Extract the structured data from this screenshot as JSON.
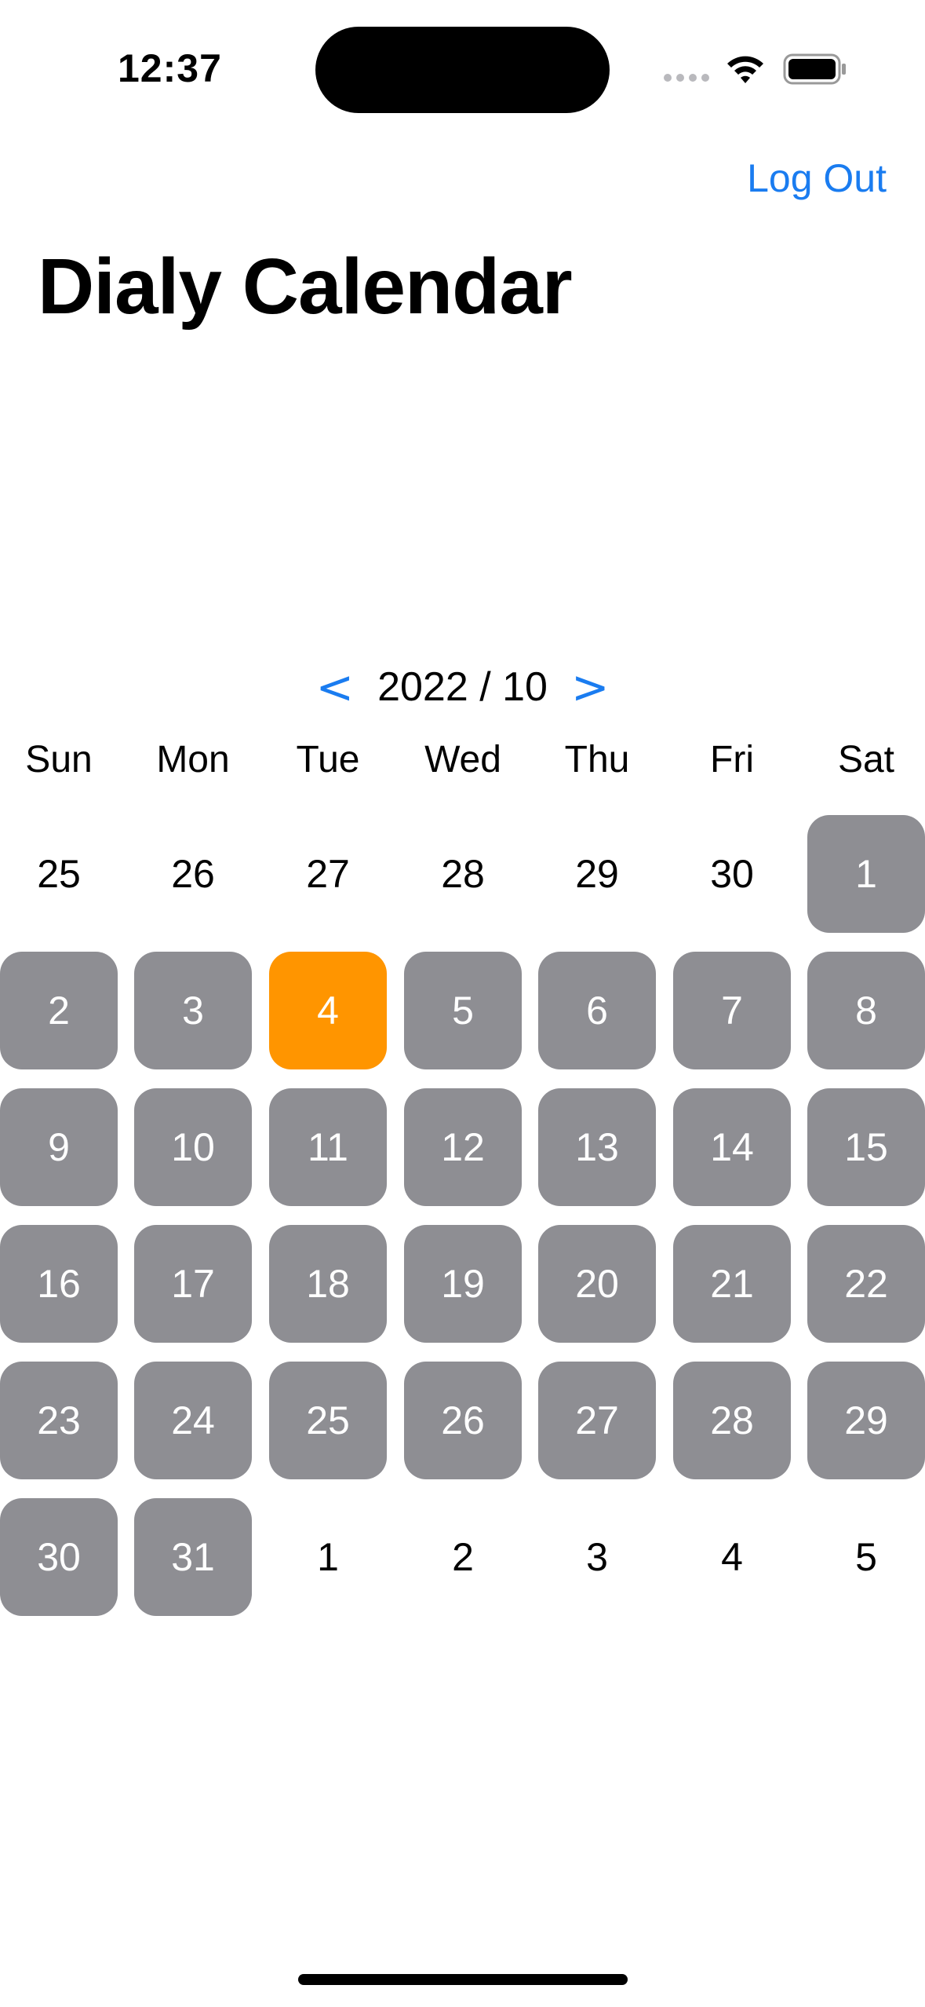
{
  "status_bar": {
    "time": "12:37",
    "icons": [
      "signal-dots-icon",
      "wifi-icon",
      "battery-icon"
    ]
  },
  "nav": {
    "logout_label": "Log Out"
  },
  "title": "Dialy Calendar",
  "calendar": {
    "prev_label": "<",
    "next_label": ">",
    "month_label": "2022 / 10",
    "weekdays": [
      "Sun",
      "Mon",
      "Tue",
      "Wed",
      "Thu",
      "Fri",
      "Sat"
    ],
    "weeks": [
      [
        {
          "day": "25",
          "in_month": false
        },
        {
          "day": "26",
          "in_month": false
        },
        {
          "day": "27",
          "in_month": false
        },
        {
          "day": "28",
          "in_month": false
        },
        {
          "day": "29",
          "in_month": false
        },
        {
          "day": "30",
          "in_month": false
        },
        {
          "day": "1",
          "in_month": true
        }
      ],
      [
        {
          "day": "2",
          "in_month": true
        },
        {
          "day": "3",
          "in_month": true
        },
        {
          "day": "4",
          "in_month": true,
          "selected": true
        },
        {
          "day": "5",
          "in_month": true
        },
        {
          "day": "6",
          "in_month": true
        },
        {
          "day": "7",
          "in_month": true
        },
        {
          "day": "8",
          "in_month": true
        }
      ],
      [
        {
          "day": "9",
          "in_month": true
        },
        {
          "day": "10",
          "in_month": true
        },
        {
          "day": "11",
          "in_month": true
        },
        {
          "day": "12",
          "in_month": true
        },
        {
          "day": "13",
          "in_month": true
        },
        {
          "day": "14",
          "in_month": true
        },
        {
          "day": "15",
          "in_month": true
        }
      ],
      [
        {
          "day": "16",
          "in_month": true
        },
        {
          "day": "17",
          "in_month": true
        },
        {
          "day": "18",
          "in_month": true
        },
        {
          "day": "19",
          "in_month": true
        },
        {
          "day": "20",
          "in_month": true
        },
        {
          "day": "21",
          "in_month": true
        },
        {
          "day": "22",
          "in_month": true
        }
      ],
      [
        {
          "day": "23",
          "in_month": true
        },
        {
          "day": "24",
          "in_month": true
        },
        {
          "day": "25",
          "in_month": true
        },
        {
          "day": "26",
          "in_month": true
        },
        {
          "day": "27",
          "in_month": true
        },
        {
          "day": "28",
          "in_month": true
        },
        {
          "day": "29",
          "in_month": true
        }
      ],
      [
        {
          "day": "30",
          "in_month": true
        },
        {
          "day": "31",
          "in_month": true
        },
        {
          "day": "1",
          "in_month": false
        },
        {
          "day": "2",
          "in_month": false
        },
        {
          "day": "3",
          "in_month": false
        },
        {
          "day": "4",
          "in_month": false
        },
        {
          "day": "5",
          "in_month": false
        }
      ]
    ]
  },
  "colors": {
    "accent": "#1a7cf0",
    "day_cell": "#8e8e93",
    "selected_day": "#ff9500"
  }
}
